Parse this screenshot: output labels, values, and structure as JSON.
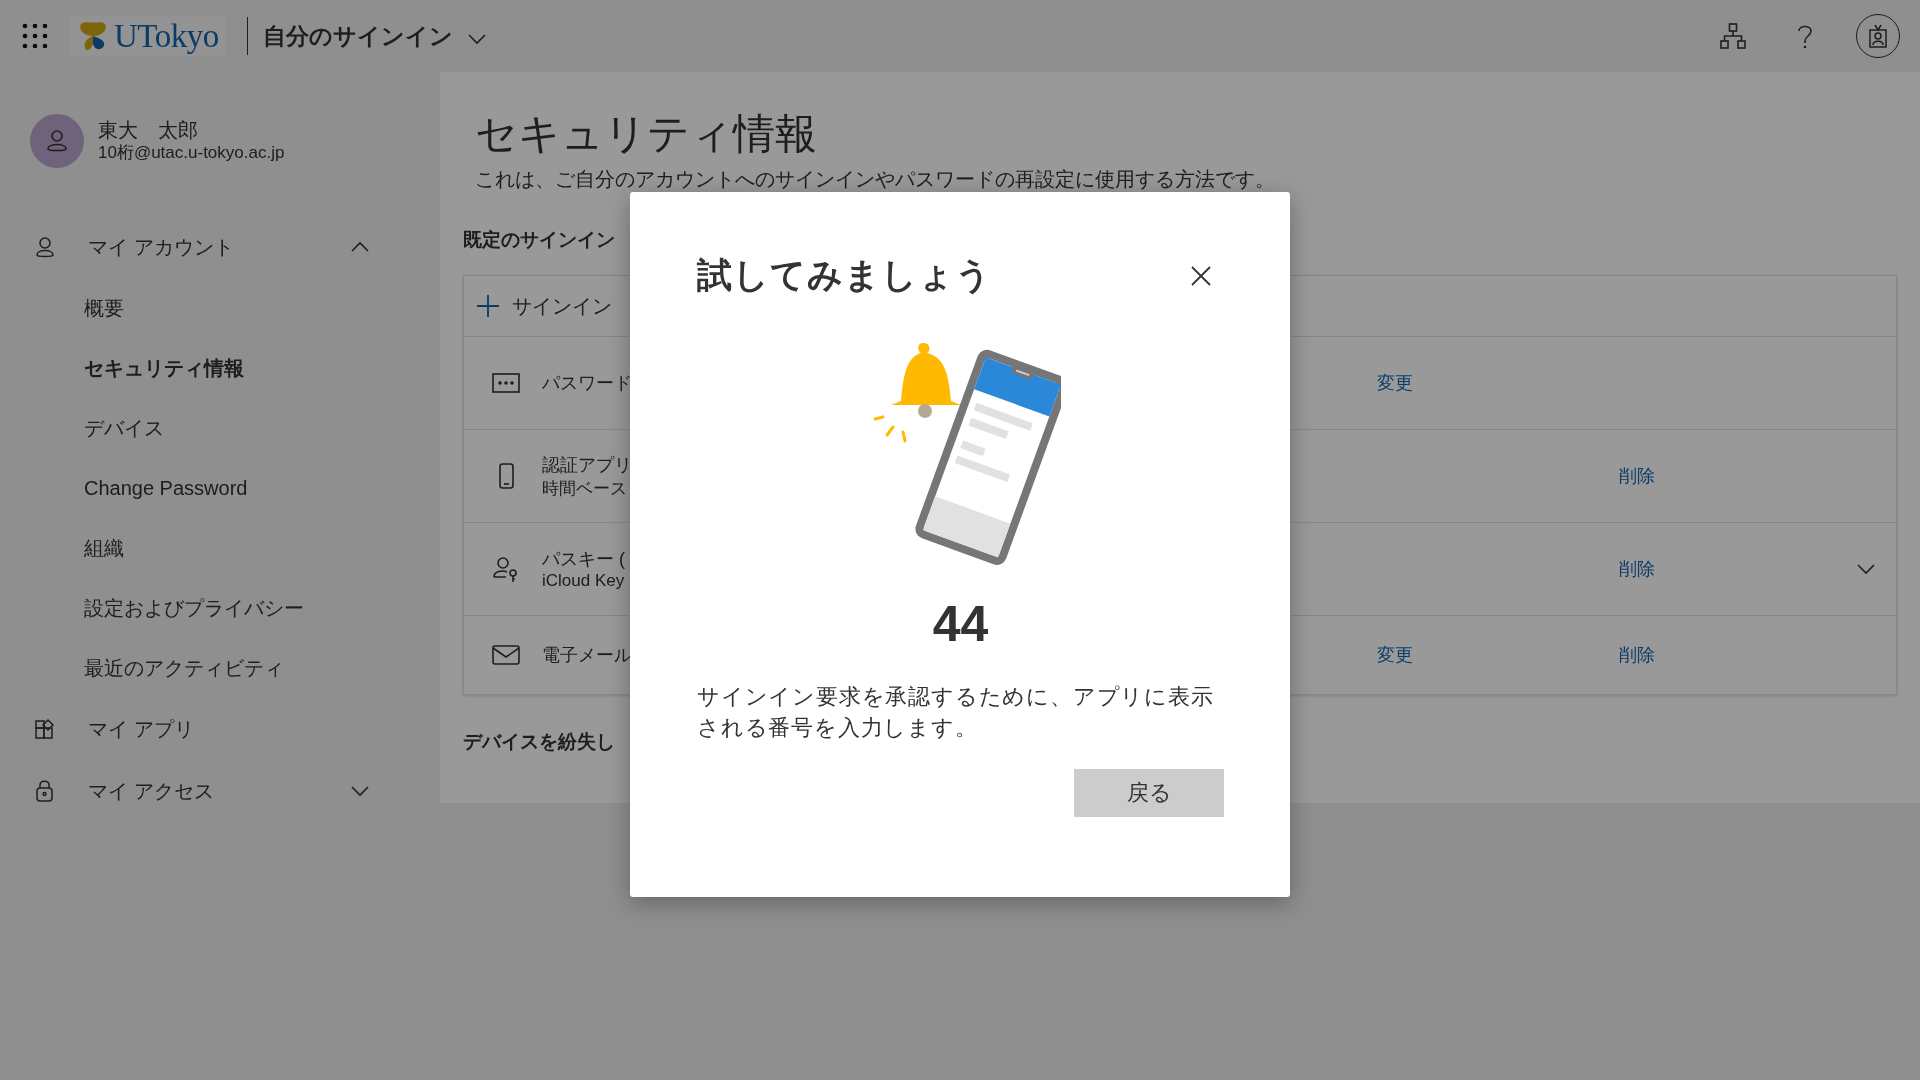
{
  "header": {
    "logo_text": "UTokyo",
    "app_title": "自分のサインイン"
  },
  "user": {
    "name": "東大　太郎",
    "email": "10桁@utac.u-tokyo.ac.jp"
  },
  "nav": [
    {
      "label": "マイ アカウント",
      "kind": "group",
      "expanded": true,
      "children": [
        {
          "label": "概要",
          "selected": false
        },
        {
          "label": "セキュリティ情報",
          "selected": true
        },
        {
          "label": "デバイス",
          "selected": false
        },
        {
          "label": "Change Password",
          "selected": false
        },
        {
          "label": "組織",
          "selected": false
        },
        {
          "label": "設定およびプライバシー",
          "selected": false
        },
        {
          "label": "最近のアクティビティ",
          "selected": false
        }
      ]
    },
    {
      "label": "マイ アプリ",
      "kind": "link"
    },
    {
      "label": "マイ アクセス",
      "kind": "group",
      "expanded": false
    }
  ],
  "page": {
    "title": "セキュリティ情報",
    "description": "これは、ご自分のアカウントへのサインインやパスワードの再設定に使用する方法です。",
    "default_method_label": "既定のサインイン",
    "add_method": "サインイン",
    "methods": [
      {
        "kind": "password",
        "name": "パスワード",
        "change": "変更"
      },
      {
        "kind": "phone",
        "name": "認証アプリ",
        "detail": "時間ベース",
        "delete": "削除"
      },
      {
        "kind": "passkey",
        "name": "パスキー (",
        "detail": "iCloud Key",
        "delete": "削除",
        "expanded": false
      },
      {
        "kind": "email",
        "name": "電子メール",
        "change": "変更",
        "delete": "削除"
      }
    ],
    "lost_device": "デバイスを紛失し"
  },
  "modal": {
    "title": "試してみましょう",
    "number": "44",
    "message": "サインイン要求を承認するために、アプリに表示される番号を入力します。",
    "button": "戻る"
  }
}
